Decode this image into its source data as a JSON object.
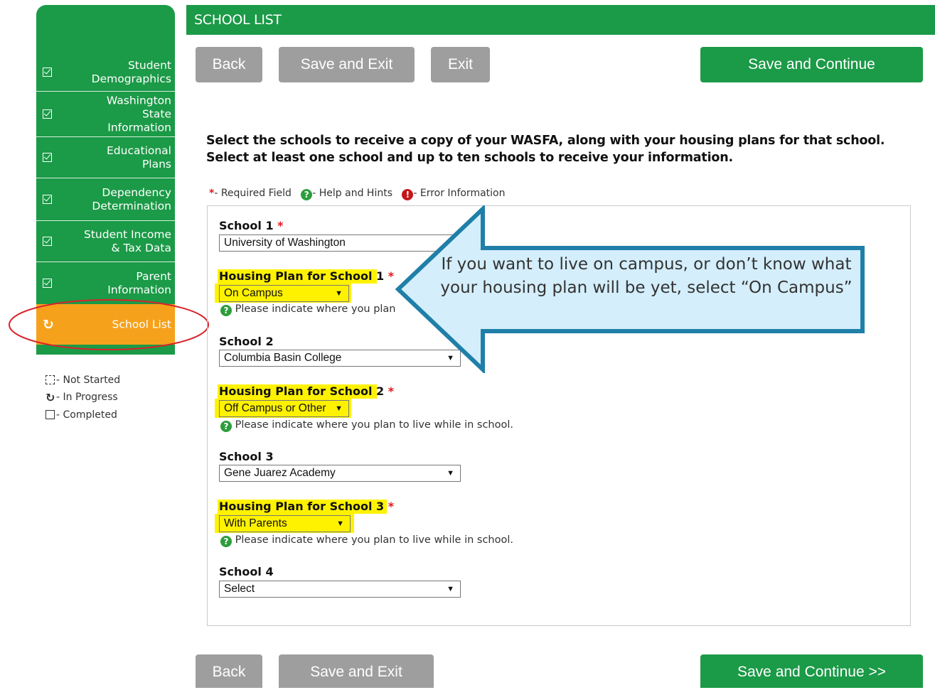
{
  "sidebar": {
    "items": [
      {
        "label": "Student\nDemographics",
        "status": "completed"
      },
      {
        "label": "Washington\nState\nInformation",
        "status": "completed"
      },
      {
        "label": "Educational\nPlans",
        "status": "completed"
      },
      {
        "label": "Dependency\nDetermination",
        "status": "completed"
      },
      {
        "label": "Student Income\n& Tax Data",
        "status": "completed"
      },
      {
        "label": "Parent\nInformation",
        "status": "completed"
      },
      {
        "label": "School List",
        "status": "in-progress"
      }
    ],
    "legend": {
      "not_started": "- Not Started",
      "in_progress": "- In Progress",
      "completed": "- Completed"
    }
  },
  "header": {
    "title": "SCHOOL LIST"
  },
  "toolbar_top": {
    "back": "Back",
    "save_exit": "Save and Exit",
    "exit": "Exit",
    "save_continue": "Save and Continue"
  },
  "intro": {
    "line1": "Select the schools to receive a copy of your WASFA, along with your housing plans for that school.",
    "line2": "Select at least one school and up to ten schools to receive your information."
  },
  "legend": {
    "required": "- Required Field",
    "help": "- Help and Hints",
    "error": "- Error Information"
  },
  "form": {
    "school1": {
      "label": "School 1",
      "value": "University of Washington"
    },
    "housing1": {
      "label": "Housing Plan for School 1",
      "value": "On Campus",
      "hint": "Please indicate where you plan"
    },
    "school2": {
      "label": "School 2",
      "value": "Columbia Basin College"
    },
    "housing2": {
      "label": "Housing Plan for School 2",
      "value": "Off Campus or Other",
      "hint": "Please indicate where you plan to live while in school."
    },
    "school3": {
      "label": "School 3",
      "value": "Gene Juarez Academy"
    },
    "housing3": {
      "label": "Housing Plan for School 3",
      "value": "With Parents",
      "hint": "Please indicate where you plan to live while in school."
    },
    "school4": {
      "label": "School 4",
      "value": "Select"
    }
  },
  "callout": {
    "text": "If you want to live on campus, or don’t know what your housing plan will be yet, select “On Campus”"
  },
  "toolbar_bottom": {
    "back": "Back",
    "save_exit": "Save and Exit",
    "save_continue": "Save and Continue >>"
  },
  "colors": {
    "brand_green": "#1b9a47",
    "active_orange": "#f6a11c",
    "button_gray": "#9e9e9e",
    "highlight_yellow": "#fff200",
    "callout_fill": "#d4eefb",
    "callout_border": "#1f7fa8",
    "annotation_red": "#d9232a"
  }
}
